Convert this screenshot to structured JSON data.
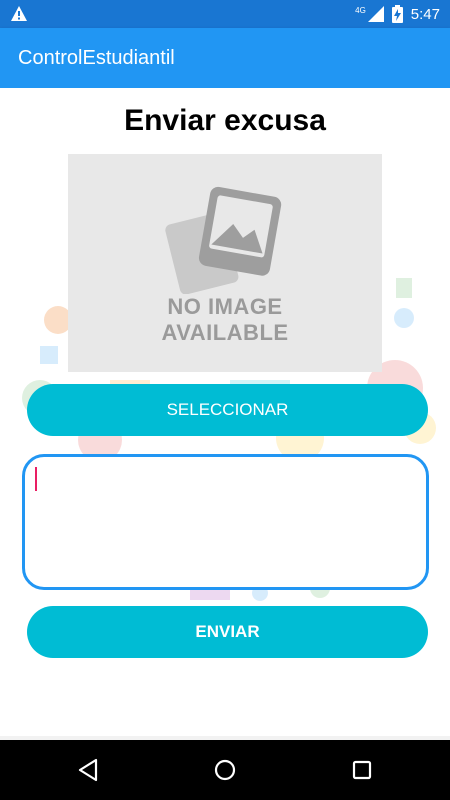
{
  "status_bar": {
    "time": "5:47",
    "network": "4G",
    "icons": [
      "warning-icon",
      "signal-icon",
      "battery-icon"
    ]
  },
  "app_bar": {
    "title": "ControlEstudiantil"
  },
  "main": {
    "heading": "Enviar excusa",
    "image_placeholder": {
      "line1": "NO IMAGE",
      "line2": "AVAILABLE"
    },
    "select_button_label": "SELECCIONAR",
    "message_field": {
      "value": "",
      "placeholder": ""
    },
    "send_button_label": "ENVIAR"
  },
  "nav_bar": {
    "icons": [
      "back-icon",
      "home-icon",
      "recents-icon"
    ]
  },
  "colors": {
    "status_bar": "#1976D2",
    "app_bar": "#2196F3",
    "button": "#00BCD4",
    "field_border": "#2196F3",
    "caret": "#E91E63"
  }
}
